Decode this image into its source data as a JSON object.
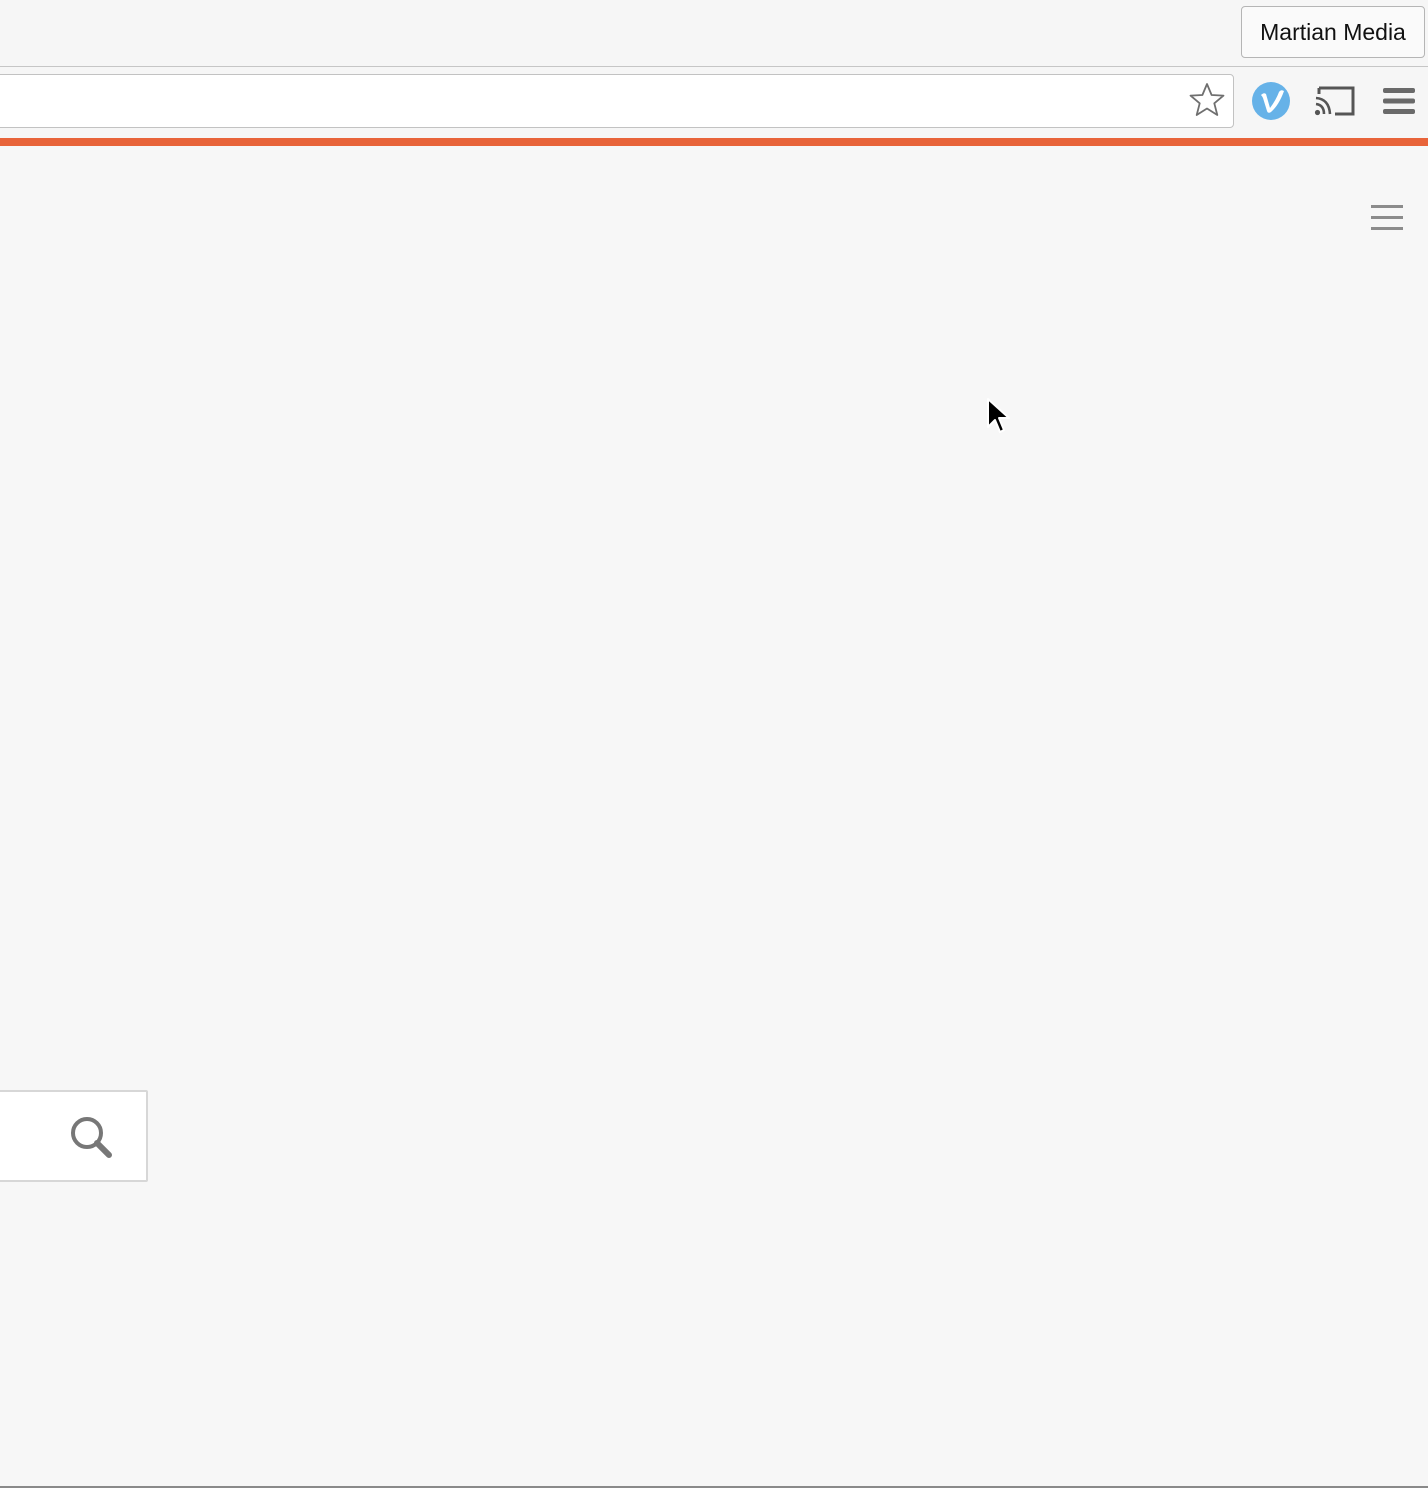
{
  "browser": {
    "profile_label": "Martian Media",
    "icons": {
      "bookmark": "star-icon",
      "extension": "vimeo-extension-icon",
      "cast": "cast-icon",
      "menu": "hamburger-menu-icon"
    },
    "accent_color": "#e8643a"
  },
  "page": {
    "menu_icon": "hamburger-menu-icon",
    "search": {
      "icon": "search-icon",
      "value": ""
    }
  }
}
